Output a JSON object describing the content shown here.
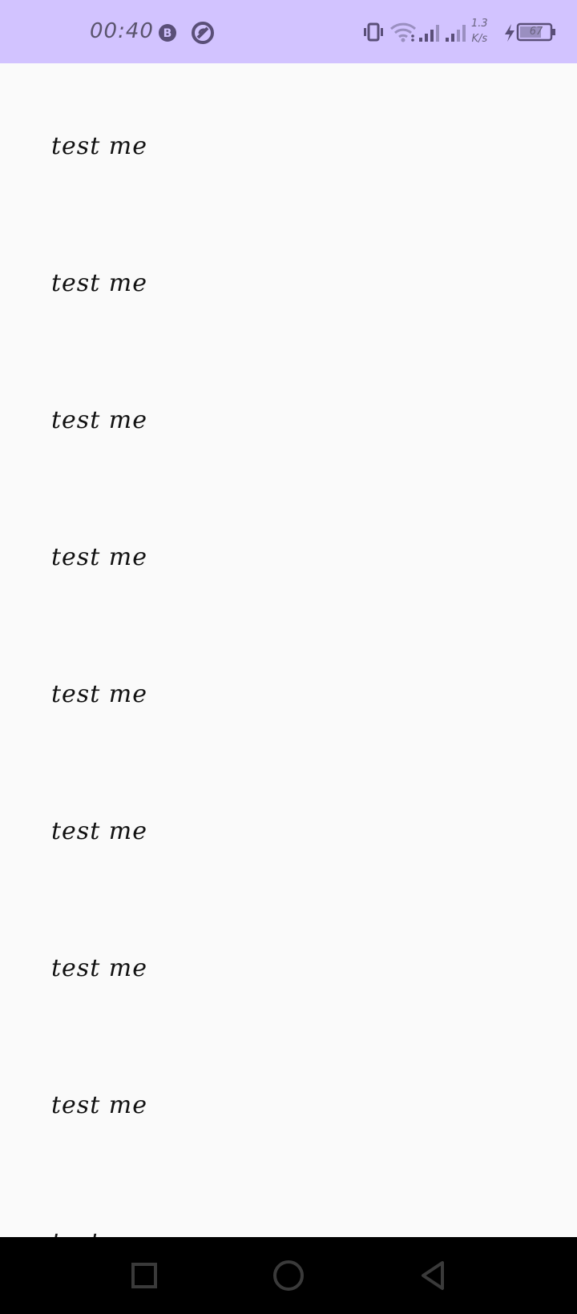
{
  "status_bar": {
    "time": "00:40",
    "net_speed_value": "1.3",
    "net_speed_unit": "K/s",
    "battery_level": "67",
    "background_color": "#d2c3ff",
    "icons": [
      "b-badge-icon",
      "sync-blocked-icon",
      "vibrate-icon",
      "wifi-icon",
      "signal-strength-icon",
      "signal-strength-2-icon",
      "charging-bolt-icon",
      "battery-icon"
    ]
  },
  "list": {
    "items": [
      {
        "label": "test me"
      },
      {
        "label": "test me"
      },
      {
        "label": "test me"
      },
      {
        "label": "test me"
      },
      {
        "label": "test me"
      },
      {
        "label": "test me"
      },
      {
        "label": "test me"
      },
      {
        "label": "test me"
      },
      {
        "label": "test me"
      }
    ]
  },
  "nav_bar": {
    "buttons": [
      "recents-square-icon",
      "home-circle-icon",
      "back-triangle-icon"
    ]
  }
}
